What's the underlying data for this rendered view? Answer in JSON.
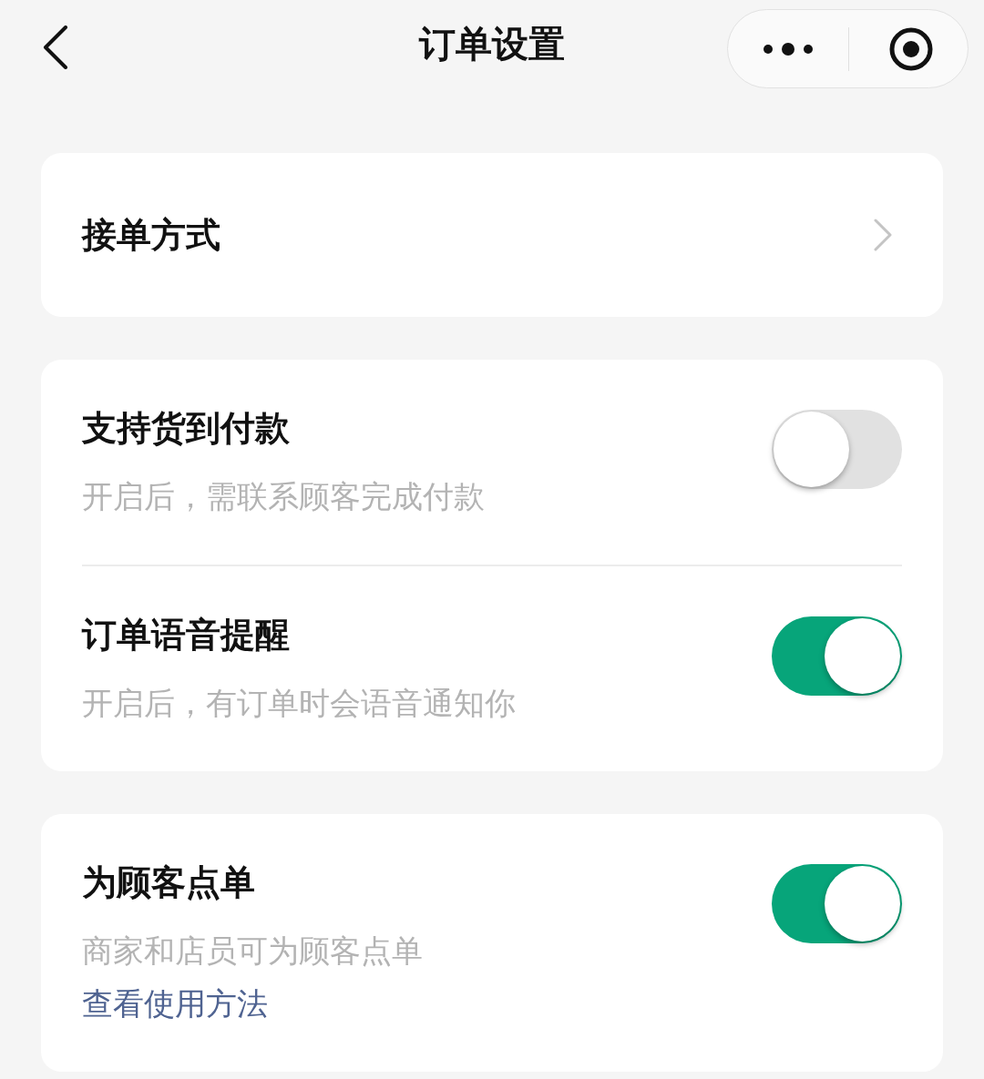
{
  "header": {
    "title": "订单设置"
  },
  "cards": [
    {
      "rows": [
        {
          "kind": "link",
          "title": "接单方式"
        }
      ]
    },
    {
      "rows": [
        {
          "kind": "switch",
          "title": "支持货到付款",
          "description": "开启后，需联系顾客完成付款",
          "on": false
        },
        {
          "kind": "switch",
          "title": "订单语音提醒",
          "description": "开启后，有订单时会语音通知你",
          "on": true
        }
      ]
    },
    {
      "rows": [
        {
          "kind": "switch",
          "title": "为顾客点单",
          "description": "商家和店员可为顾客点单",
          "on": true,
          "link": "查看使用方法"
        }
      ]
    }
  ]
}
